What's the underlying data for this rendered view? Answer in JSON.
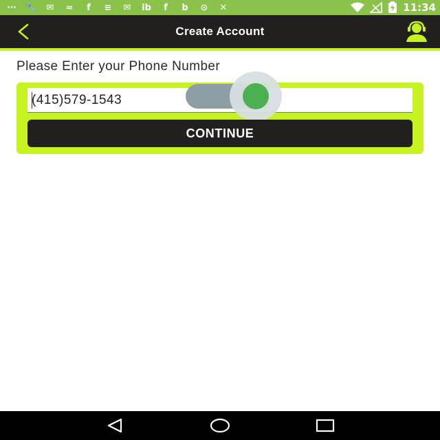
{
  "status_bar": {
    "time": "11:34",
    "left_icons": [
      {
        "name": "chat-bubble-icon",
        "glyph": "⋯"
      },
      {
        "name": "wrench-icon",
        "glyph": "🔧"
      },
      {
        "name": "bbm-icon",
        "glyph": "✉"
      },
      {
        "name": "zap-icon",
        "glyph": "≈"
      },
      {
        "name": "facebook-icon",
        "glyph": "f"
      },
      {
        "name": "stack-icon",
        "glyph": "≡"
      },
      {
        "name": "message-icon",
        "glyph": "✉"
      },
      {
        "name": "ib-icon",
        "glyph": "ib"
      },
      {
        "name": "facebook-icon-2",
        "glyph": "f"
      },
      {
        "name": "b-icon",
        "glyph": "b"
      },
      {
        "name": "circle-info-icon",
        "glyph": "⊙"
      },
      {
        "name": "no-signal-icon",
        "glyph": "✕"
      }
    ]
  },
  "app_bar": {
    "title": "Create Account",
    "back_icon": "chevron-left-icon",
    "support_icon": "support-agent-icon",
    "accent_color": "#c6f21f",
    "background_color": "#221f1f"
  },
  "form": {
    "prompt": "Please Enter your Phone Number",
    "phone_value": "(415)579-1543",
    "toggle_on": true,
    "continue_label": "CONTINUE"
  },
  "nav_bar": {
    "back_icon": "nav-back-icon",
    "home_icon": "nav-home-icon",
    "recents_icon": "nav-recents-icon"
  }
}
